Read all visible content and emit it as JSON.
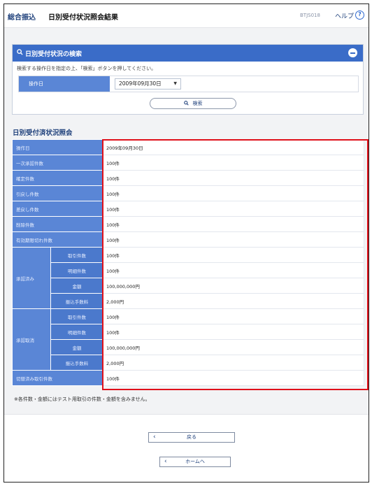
{
  "header": {
    "category": "総合振込",
    "title": "日別受付状況照会結果",
    "screen_code": "BTJS018",
    "help_label": "ヘルプ",
    "help_icon": "?"
  },
  "search": {
    "icon": "search-icon",
    "title": "日別受付状況の検索",
    "instruction": "検索する操作日を指定の上、「検索」ボタンを押してください。",
    "field_label": "操作日",
    "selected_date": "2009年09月30日",
    "button_label": "検索"
  },
  "results": {
    "section_title": "日別受付済状況照会",
    "rows": [
      {
        "label": "操作日",
        "value": "2009年09月30日"
      },
      {
        "label": "一次承認件数",
        "value": "100件"
      },
      {
        "label": "確定件数",
        "value": "100件"
      },
      {
        "label": "引戻し件数",
        "value": "100件"
      },
      {
        "label": "差戻し件数",
        "value": "100件"
      },
      {
        "label": "削除件数",
        "value": "100件"
      },
      {
        "label": "有効期限切れ件数",
        "value": "100件"
      }
    ],
    "groups": [
      {
        "label": "承認済み",
        "rows": [
          {
            "label": "取引件数",
            "value": "100件"
          },
          {
            "label": "明細件数",
            "value": "100件"
          },
          {
            "label": "金額",
            "value": "100,000,000円"
          },
          {
            "label": "振込手数料",
            "value": "2,000円"
          }
        ]
      },
      {
        "label": "承認取消",
        "rows": [
          {
            "label": "取引件数",
            "value": "100件"
          },
          {
            "label": "明細件数",
            "value": "100件"
          },
          {
            "label": "金額",
            "value": "100,000,000円"
          },
          {
            "label": "振込手数料",
            "value": "2,000円"
          }
        ]
      }
    ],
    "last_row": {
      "label": "切替済み取引件数",
      "value": "100件"
    },
    "note": "※各件数・金額にはテスト用取引の件数・金額を含みません。"
  },
  "footer": {
    "back_label": "戻る",
    "home_label": "ホームへ"
  },
  "colors": {
    "accent": "#3a6cc8",
    "label_bg": "#5a86d6",
    "highlight": "#e0101a"
  }
}
